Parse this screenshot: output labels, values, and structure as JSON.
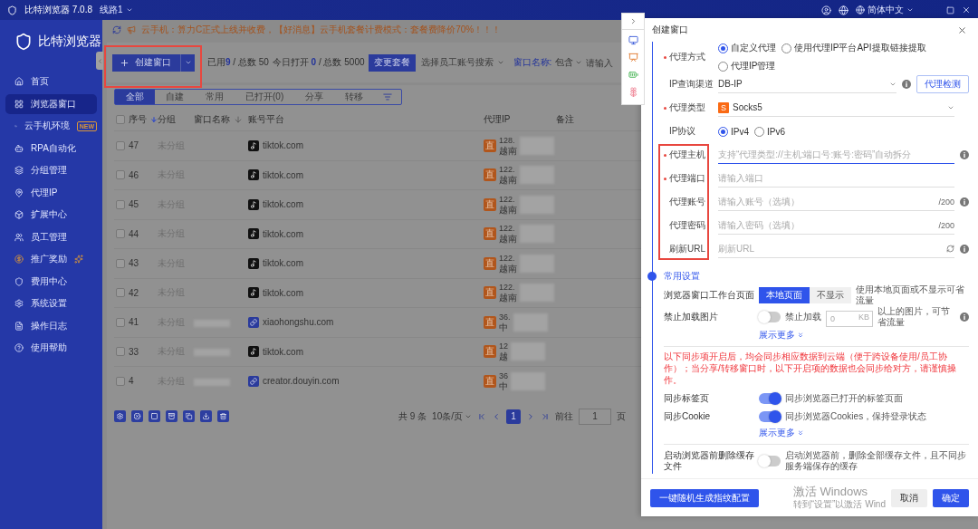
{
  "title_bar": {
    "app": "比特浏览器 7.0.8",
    "route": "线路1",
    "language": "简体中文"
  },
  "sidebar": {
    "brand": "比特浏览器",
    "items": [
      {
        "label": "首页",
        "selected": false
      },
      {
        "label": "浏览器窗口",
        "selected": true
      },
      {
        "label": "云手机环境",
        "selected": false,
        "badge": "NEW"
      },
      {
        "label": "RPA自动化",
        "selected": false
      },
      {
        "label": "分组管理",
        "selected": false
      },
      {
        "label": "代理IP",
        "selected": false
      },
      {
        "label": "扩展中心",
        "selected": false
      },
      {
        "label": "员工管理",
        "selected": false
      },
      {
        "label": "推广奖励",
        "selected": false
      },
      {
        "label": "费用中心",
        "selected": false
      },
      {
        "label": "系统设置",
        "selected": false
      },
      {
        "label": "操作日志",
        "selected": false
      },
      {
        "label": "使用帮助",
        "selected": false
      }
    ]
  },
  "notice": "云手机：算力C正式上线并收费，【好消息】云手机套餐计费模式：套餐费降价70%！！！",
  "toolbar": {
    "create_button": "创建窗口",
    "used": "已用**9** / 总数 50",
    "opened": "今日打开 **0** / 总数 5000",
    "plan_button": "变更套餐",
    "staff_select": {
      "placeholder": "选择员工账号搜索"
    },
    "name_filter": {
      "label": "窗口名称:",
      "mode": "包含",
      "placeholder": "请输入"
    }
  },
  "tabs": [
    {
      "label": "全部",
      "selected": true
    },
    {
      "label": "自建",
      "selected": false
    },
    {
      "label": "常用",
      "selected": false
    },
    {
      "label": "已打开(0)",
      "selected": false
    },
    {
      "label": "分享",
      "selected": false
    },
    {
      "label": "转移",
      "selected": false
    }
  ],
  "table": {
    "all_checked": false,
    "columns": [
      {
        "label": "序号",
        "sort_arrow": true,
        "sort_active": true
      },
      {
        "label": "分组",
        "sort_arrow": false
      },
      {
        "label": "窗口名称",
        "sort_arrow": true,
        "sort_active": false
      },
      {
        "label": "账号平台",
        "sort_arrow": false
      },
      {
        "label": "代理IP",
        "sort_arrow": false
      },
      {
        "label": "备注",
        "sort_arrow": false
      }
    ],
    "rows": [
      {
        "checked": false,
        "seq": "47",
        "group": "未分组",
        "name_hidden": false,
        "kind": "tiktok",
        "platform": "tiktok.com",
        "proxy_badge": "直",
        "ip": "128.",
        "region": "越南"
      },
      {
        "checked": false,
        "seq": "46",
        "group": "未分组",
        "name_hidden": false,
        "kind": "tiktok",
        "platform": "tiktok.com",
        "proxy_badge": "直",
        "ip": "122.",
        "region": "越南"
      },
      {
        "checked": false,
        "seq": "45",
        "group": "未分组",
        "name_hidden": false,
        "kind": "tiktok",
        "platform": "tiktok.com",
        "proxy_badge": "直",
        "ip": "122.",
        "region": "越南"
      },
      {
        "checked": false,
        "seq": "44",
        "group": "未分组",
        "name_hidden": false,
        "kind": "tiktok",
        "platform": "tiktok.com",
        "proxy_badge": "直",
        "ip": "122.",
        "region": "越南"
      },
      {
        "checked": false,
        "seq": "43",
        "group": "未分组",
        "name_hidden": false,
        "kind": "tiktok",
        "platform": "tiktok.com",
        "proxy_badge": "直",
        "ip": "122.",
        "region": "越南"
      },
      {
        "checked": false,
        "seq": "42",
        "group": "未分组",
        "name_hidden": false,
        "kind": "tiktok",
        "platform": "tiktok.com",
        "proxy_badge": "直",
        "ip": "122.",
        "region": "越南"
      },
      {
        "checked": false,
        "seq": "41",
        "group": "未分组",
        "name_hidden": true,
        "kind": "link",
        "platform": "xiaohongshu.com",
        "proxy_badge": "直",
        "ip": "36.",
        "region": "中"
      },
      {
        "checked": false,
        "seq": "33",
        "group": "未分组",
        "name_hidden": true,
        "kind": "tiktok",
        "platform": "tiktok.com",
        "proxy_badge": "直",
        "ip": "12",
        "region": "越"
      },
      {
        "checked": false,
        "seq": "4",
        "group": "未分组",
        "name_hidden": true,
        "kind": "link",
        "platform": "creator.douyin.com",
        "proxy_badge": "直",
        "ip": "36",
        "region": "中"
      }
    ]
  },
  "pagination": {
    "total": "共 9 条",
    "page_size": "10条/页",
    "pages": [
      {
        "label": "1",
        "selected": true
      }
    ],
    "goto_label": "前往",
    "goto_value": "1",
    "page_unit": "页"
  },
  "drawer": {
    "title": "创建窗口",
    "proxy_fields": [
      {
        "kind": "radio",
        "label": "代理方式",
        "required": true,
        "options": [
          {
            "label": "自定义代理",
            "selected": true
          },
          {
            "label": "使用代理IP平台API提取链接提取",
            "selected": false
          },
          {
            "label": "代理IP管理",
            "selected": false
          }
        ]
      },
      {
        "kind": "select",
        "label": "IP查询渠道",
        "required": false,
        "value": "DB-IP",
        "info": true,
        "button": "代理检测"
      },
      {
        "kind": "select",
        "label": "代理类型",
        "required": true,
        "value": "Socks5",
        "value_icon": "S",
        "info": false
      },
      {
        "kind": "radio",
        "label": "IP协议",
        "required": false,
        "options": [
          {
            "label": "IPv4",
            "selected": true
          },
          {
            "label": "IPv6",
            "selected": false
          }
        ]
      },
      {
        "kind": "input",
        "label": "代理主机",
        "required": true,
        "placeholder": "支持“代理类型://主机:端口号:账号:密码”自动拆分",
        "focused": true,
        "info": true
      },
      {
        "kind": "input",
        "label": "代理端口",
        "required": true,
        "placeholder": "请输入端口",
        "focused": false,
        "info": false
      },
      {
        "kind": "input",
        "label": "代理账号",
        "required": false,
        "placeholder": "请输入账号（选填）",
        "counter": "/200",
        "focused": false,
        "info": true
      },
      {
        "kind": "input",
        "label": "代理密码",
        "required": false,
        "placeholder": "请输入密码（选填）",
        "counter": "/200",
        "focused": false,
        "info": false
      },
      {
        "kind": "input",
        "label": "刷新URL",
        "required": false,
        "placeholder": "刷新URL",
        "refresh": true,
        "focused": false,
        "info": true
      }
    ],
    "common": {
      "title": "常用设置",
      "workbench": {
        "label": "浏览器窗口工作台页面",
        "options": [
          {
            "label": "本地页面",
            "selected": true
          },
          {
            "label": "不显示",
            "selected": false
          }
        ],
        "hint": "使用本地页面或不显示可省流量"
      },
      "images": {
        "label": "禁止加载图片",
        "on": false,
        "toggle_label": "禁止加载",
        "size_value": "0",
        "unit": "KB",
        "hint": "以上的图片，可节省流量"
      },
      "more_1": "展示更多",
      "warning": "以下同步项开启后，均会同步相应数据到云端（便于跨设备使用/员工协作）；当分享/转移窗口时，以下开启项的数据也会同步给对方，请谨慎操作。",
      "sync": [
        {
          "label": "同步标签页",
          "on": true,
          "hint": "同步浏览器已打开的标签页面"
        },
        {
          "label": "同步Cookie",
          "on": true,
          "hint": "同步浏览器Cookies，保持登录状态"
        }
      ],
      "more_2": "展示更多",
      "cache": {
        "label": "启动浏览器前删除缓存文件",
        "on": false,
        "hint": "启动浏览器前，删除全部缓存文件，且不同步服务端保存的缓存"
      }
    },
    "footer": {
      "random_button": "一键随机生成指纹配置",
      "cancel": "取消",
      "confirm": "确定"
    }
  },
  "os_notice": {
    "title": "激活 Windows",
    "text": "转到“设置”以激活 Wind"
  }
}
